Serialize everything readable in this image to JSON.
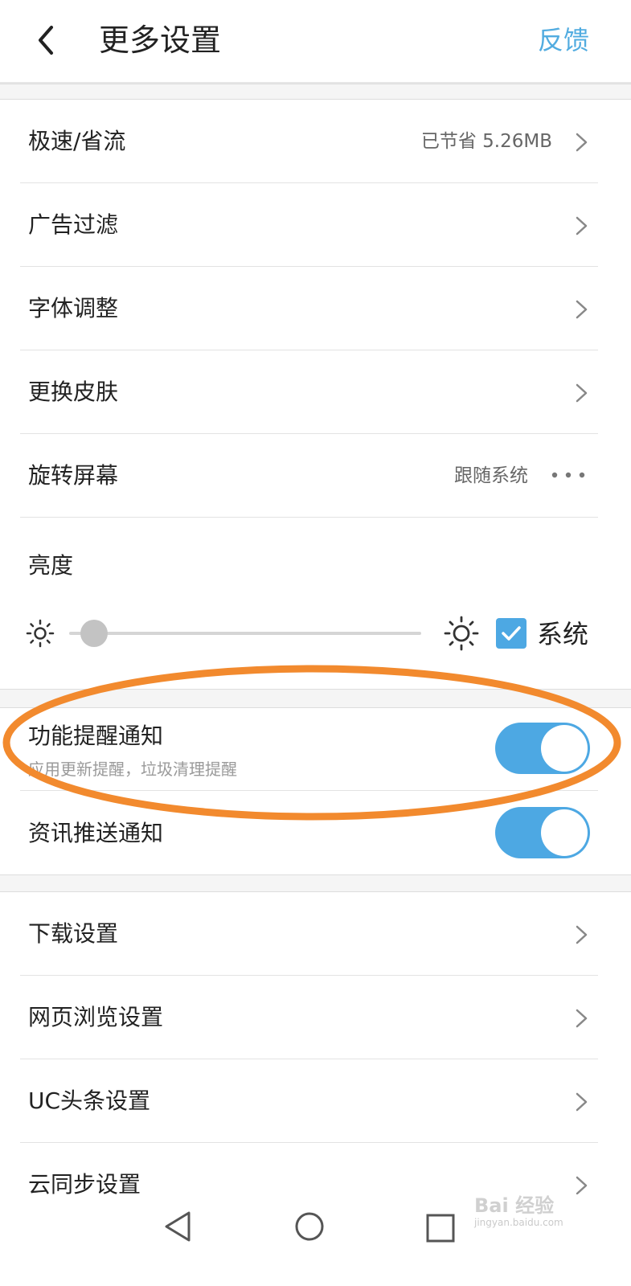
{
  "header": {
    "title": "更多设置",
    "feedback_label": "反馈"
  },
  "settings_group1": {
    "items": [
      {
        "label": "极速/省流",
        "value": "已节省 5.26MB"
      },
      {
        "label": "广告过滤"
      },
      {
        "label": "字体调整"
      },
      {
        "label": "更换皮肤"
      },
      {
        "label": "旋转屏幕",
        "value": "跟随系统"
      }
    ]
  },
  "brightness": {
    "label": "亮度",
    "level": 0.07,
    "system_label": "系统",
    "system_checked": true
  },
  "notifications": {
    "items": [
      {
        "title": "功能提醒通知",
        "subtitle": "应用更新提醒，垃圾清理提醒",
        "enabled": true
      },
      {
        "title": "资讯推送通知",
        "enabled": true
      }
    ]
  },
  "settings_group2": {
    "items": [
      {
        "label": "下载设置"
      },
      {
        "label": "网页浏览设置"
      },
      {
        "label": "UC头条设置"
      },
      {
        "label": "云同步设置"
      }
    ]
  },
  "watermark": {
    "text": "Bai 经验",
    "url_text": "jingyan.baidu.com"
  },
  "colors": {
    "accent": "#4da8e3",
    "feedback": "#52ace0",
    "highlight_ellipse": "#f28a2e"
  }
}
